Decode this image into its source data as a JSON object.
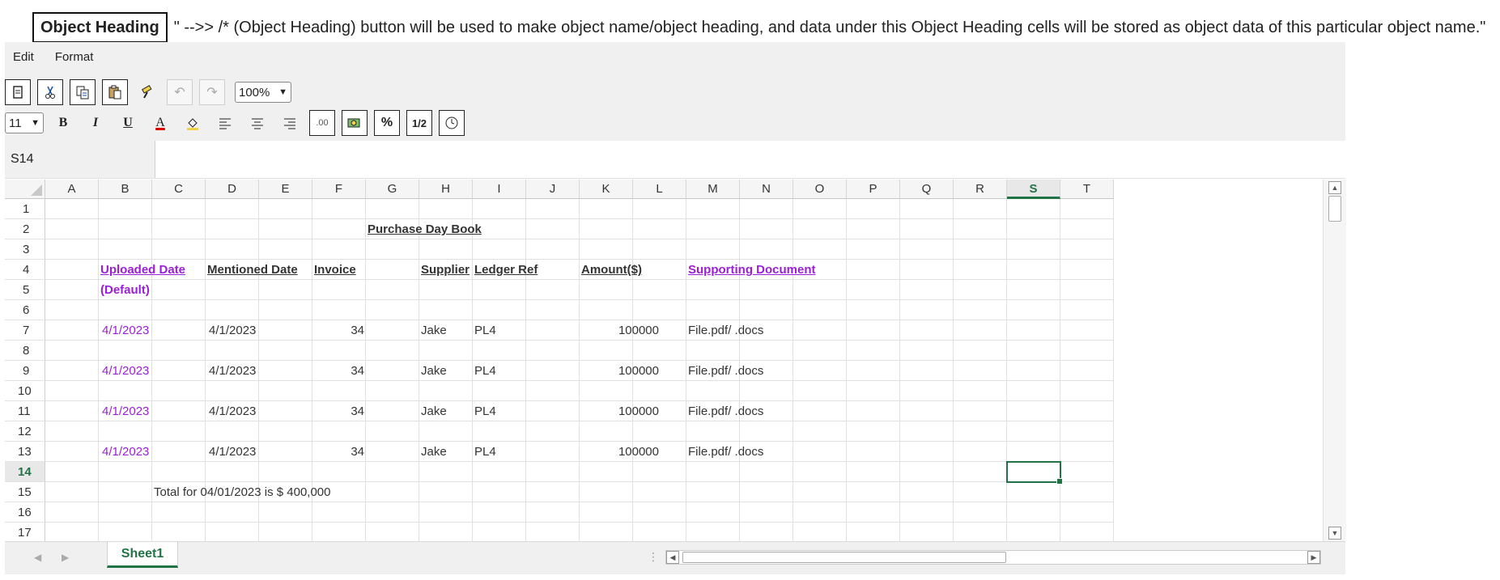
{
  "banner": {
    "button_label": "Object Heading",
    "description": "\" -->> /* (Object Heading) button will be used to make object name/object heading, and data under this Object Heading cells will be stored as object data of this particular object name.\""
  },
  "menu": [
    "Edit",
    "Format"
  ],
  "toolbar": {
    "zoom": "100%",
    "font_size": "11",
    "bold": "B",
    "italic": "I",
    "underline": "U",
    "font_color": "A",
    "decimal": ".00",
    "percent": "%",
    "fraction": "1/2",
    "icons": [
      "new-sheet-icon",
      "cut-icon",
      "copy-icon",
      "paste-icon",
      "format-painter-icon",
      "undo-icon",
      "redo-icon",
      "fill-color-icon",
      "align-left-icon",
      "align-center-icon",
      "align-right-icon",
      "currency-icon",
      "time-icon"
    ]
  },
  "name_box": "S14",
  "columns": [
    "A",
    "B",
    "C",
    "D",
    "E",
    "F",
    "G",
    "H",
    "I",
    "J",
    "K",
    "L",
    "M",
    "N",
    "O",
    "P",
    "Q",
    "R",
    "S",
    "T"
  ],
  "active_column": "S",
  "active_row": 14,
  "rows": [
    1,
    2,
    3,
    4,
    5,
    6,
    7,
    8,
    9,
    10,
    11,
    12,
    13,
    14,
    15,
    16,
    17
  ],
  "sheet": {
    "title": "Purchase Day Book",
    "headers": {
      "uploaded_date": "Uploaded Date",
      "uploaded_default": "(Default)",
      "mentioned_date": "Mentioned Date",
      "invoice": "Invoice",
      "supplier": "Supplier",
      "ledger_ref": "Ledger Ref",
      "amount": "Amount($)",
      "supporting_document": "Supporting Document"
    },
    "entries": [
      {
        "row": 7,
        "uploaded": "4/1/2023",
        "mentioned": "4/1/2023",
        "invoice": "34",
        "supplier": "Jake",
        "ledger": "PL4",
        "amount": "100000",
        "document": "File.pdf/ .docs"
      },
      {
        "row": 9,
        "uploaded": "4/1/2023",
        "mentioned": "4/1/2023",
        "invoice": "34",
        "supplier": "Jake",
        "ledger": "PL4",
        "amount": "100000",
        "document": "File.pdf/ .docs"
      },
      {
        "row": 11,
        "uploaded": "4/1/2023",
        "mentioned": "4/1/2023",
        "invoice": "34",
        "supplier": "Jake",
        "ledger": "PL4",
        "amount": "100000",
        "document": "File.pdf/ .docs"
      },
      {
        "row": 13,
        "uploaded": "4/1/2023",
        "mentioned": "4/1/2023",
        "invoice": "34",
        "supplier": "Jake",
        "ledger": "PL4",
        "amount": "100000",
        "document": "File.pdf/ .docs"
      }
    ],
    "total": "Total for 04/01/2023 is $ 400,000"
  },
  "sheet_tabs": [
    "Sheet1"
  ],
  "colors": {
    "accent": "#217346",
    "purple": "#9b1fd6",
    "toolbar_bg": "#f0f0f0"
  }
}
